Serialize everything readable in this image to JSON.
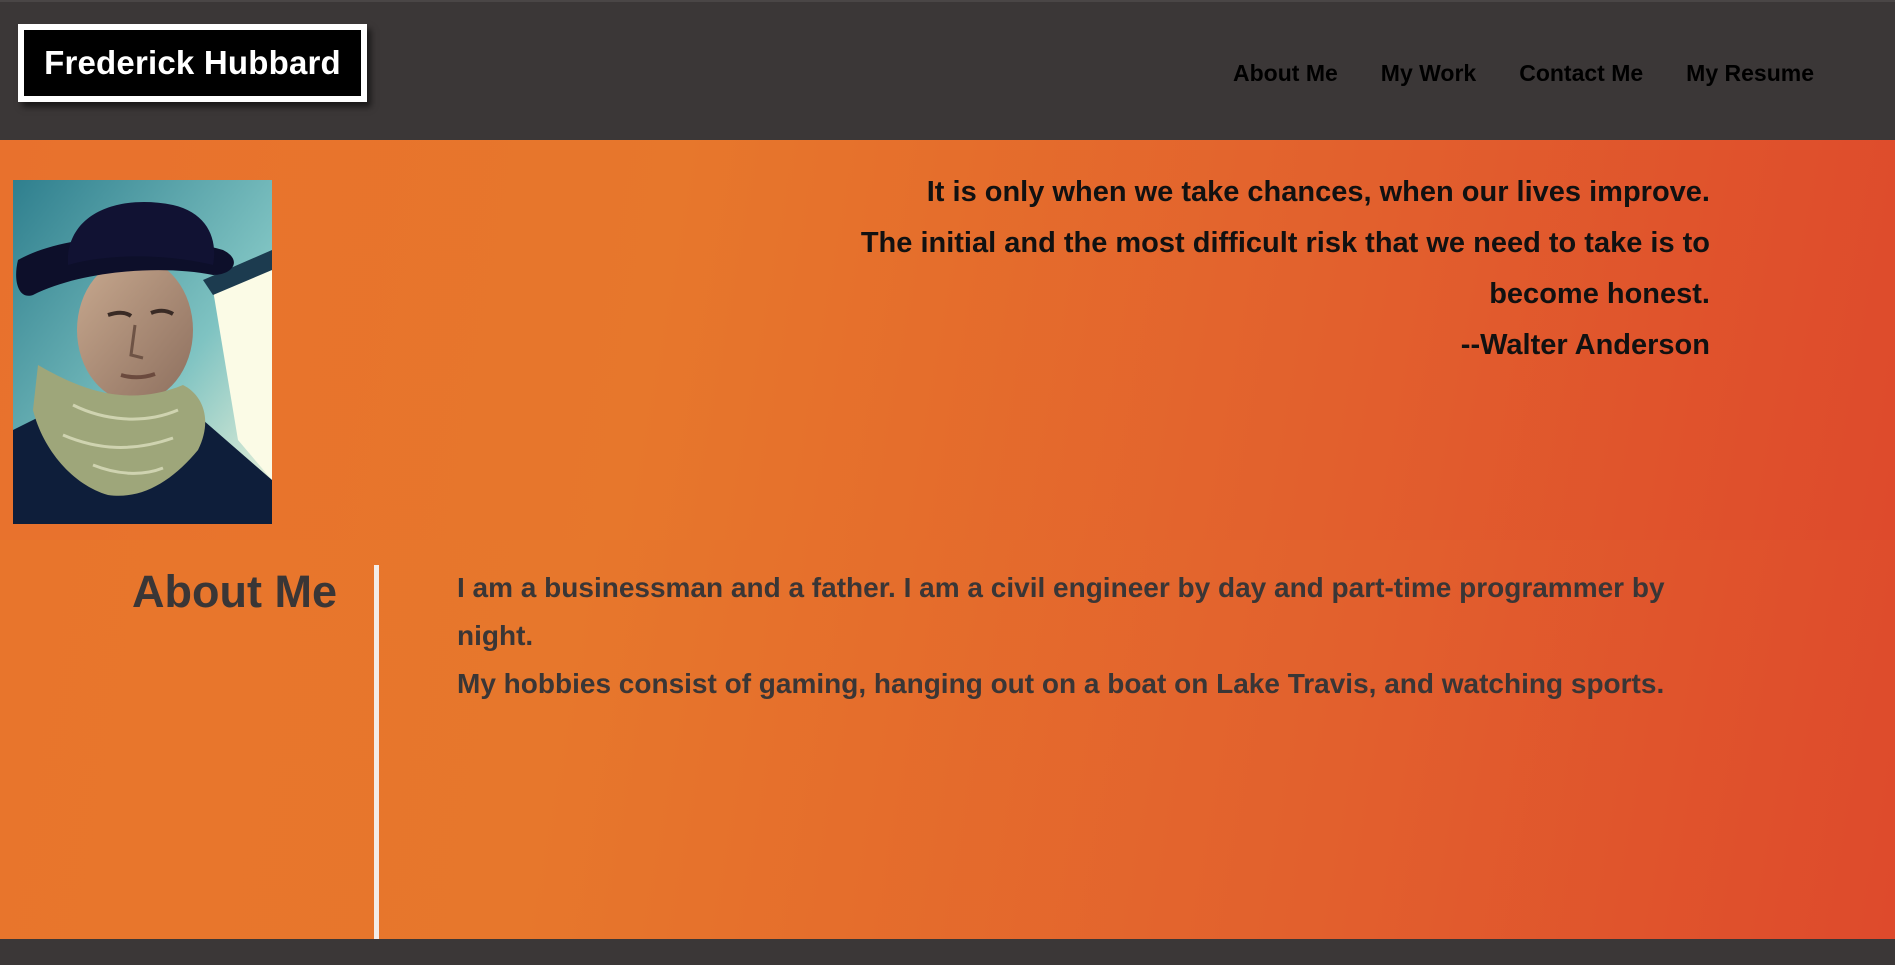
{
  "header": {
    "logo_text": "Frederick Hubbard",
    "nav": [
      {
        "label": "About Me"
      },
      {
        "label": "My Work"
      },
      {
        "label": "Contact Me"
      },
      {
        "label": "My Resume"
      }
    ]
  },
  "hero": {
    "quote_lines": [
      "It is only when we take chances, when our lives improve.",
      "The initial and the most difficult risk that we need to take is to",
      "become honest."
    ],
    "quote_author": "--Walter Anderson"
  },
  "about": {
    "title": "About Me",
    "paragraphs": [
      "I am a businessman and a father. I am a civil engineer by day and part-time programmer by night.",
      "My hobbies consist of gaming, hanging out on a boat on Lake Travis, and watching sports."
    ]
  },
  "colors": {
    "header_bg": "#3b3737",
    "accent_orange": "#e8712d",
    "accent_red": "#de4a2c",
    "text_dark": "#3a3636"
  }
}
